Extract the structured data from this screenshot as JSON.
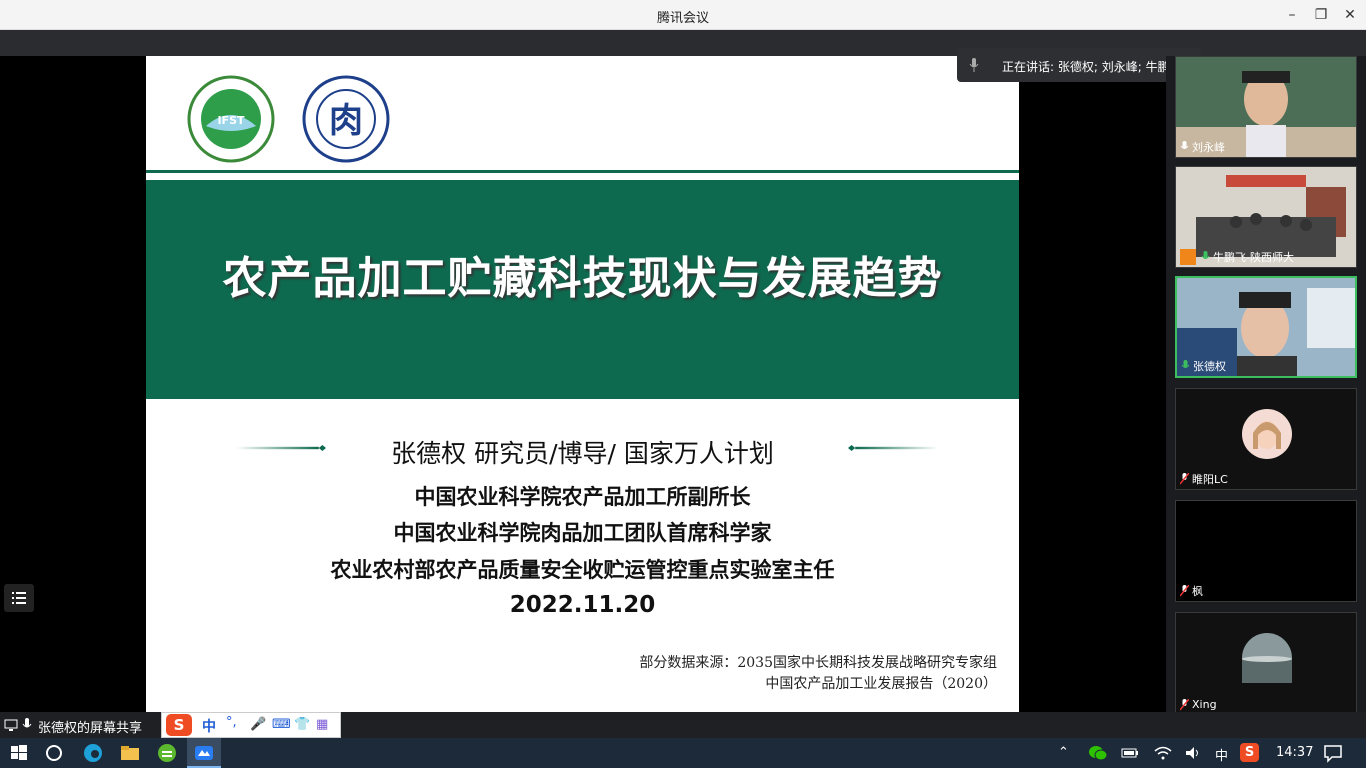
{
  "window": {
    "title": "腾讯会议"
  },
  "speaking": {
    "text": "正在讲话: 张德权; 刘永峰; 牛鹏..."
  },
  "slide": {
    "title": "农产品加工贮藏科技现状与发展趋势",
    "speaker": "张德权  研究员/博导/ 国家万人计划",
    "lines": [
      "中国农业科学院农产品加工所副所长",
      "中国农业科学院肉品加工团队首席科学家",
      "农业农村部农产品质量安全收贮运管控重点实验室主任"
    ],
    "date": "2022.11.20",
    "source_line1": "部分数据来源：2035国家中长期科技发展战略研究专家组",
    "source_line2": "中国农产品加工业发展报告（2020）",
    "logo1_text": "IFST",
    "logo2_text": "肉"
  },
  "participants": [
    {
      "name": "刘永峰",
      "mic": "on"
    },
    {
      "name": "牛鹏飞-陕西师大",
      "mic": "on"
    },
    {
      "name": "张德权",
      "mic": "on",
      "active": true
    },
    {
      "name": "睢阳LC",
      "mic": "muted"
    },
    {
      "name": "枫",
      "mic": "muted"
    },
    {
      "name": "Xing",
      "mic": "muted"
    }
  ],
  "share": {
    "label": "张德权的屏幕共享"
  },
  "ime": {
    "lang": "中",
    "punct": "°,"
  },
  "tray": {
    "lang": "中",
    "time": "14:37"
  },
  "colors": {
    "band": "#0e6a4f",
    "active_border": "#3cbf5e",
    "taskbar": "#1c2a3a"
  }
}
